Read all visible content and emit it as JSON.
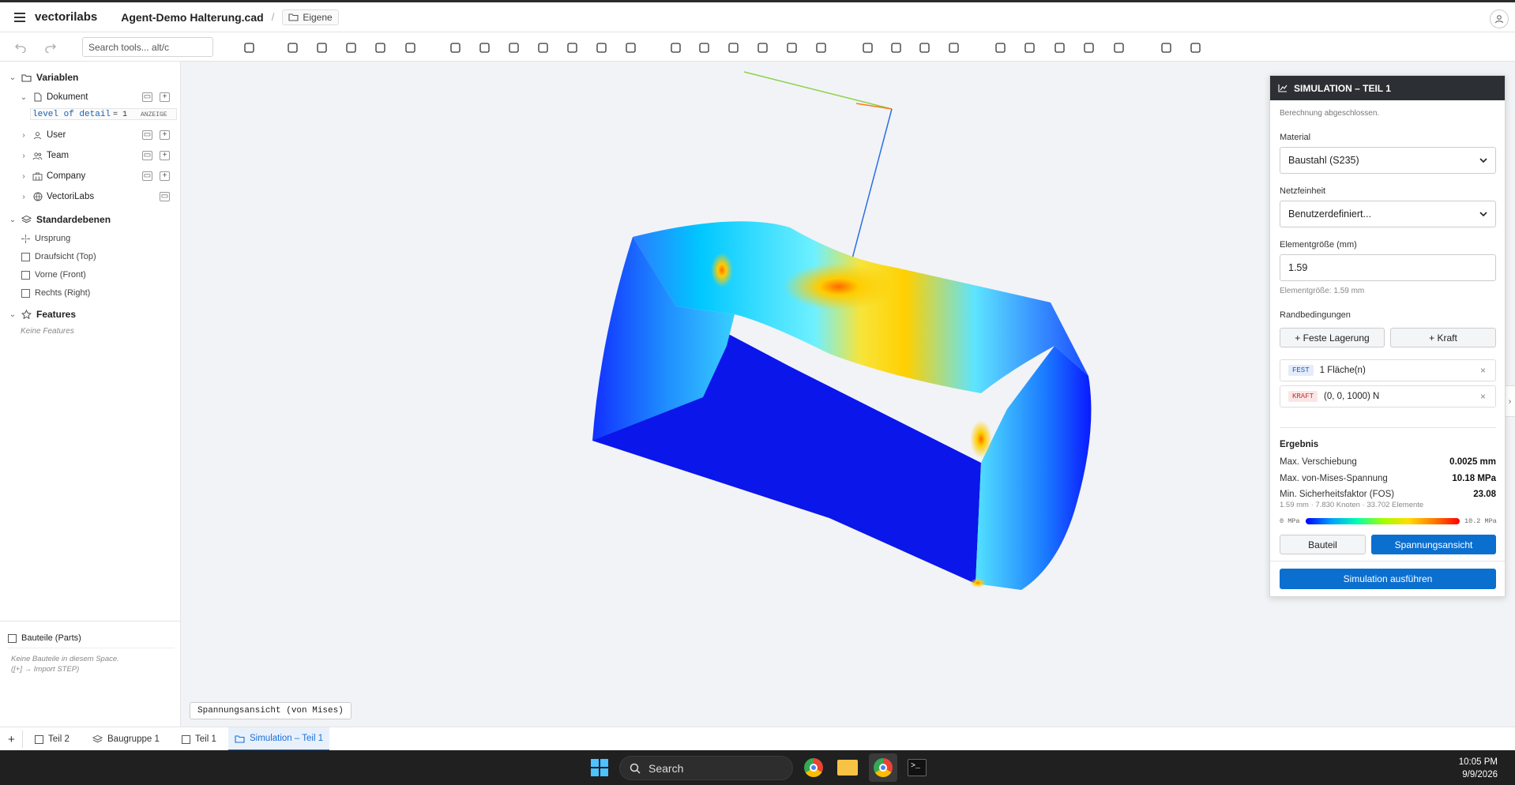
{
  "app": {
    "brand": "vectorilabs",
    "document": "Agent-Demo Halterung.cad",
    "breadcrumb_sep": "/",
    "folder": "Eigene"
  },
  "toolbar": {
    "search_placeholder": "Search tools... alt/c"
  },
  "sidebar": {
    "variables_title": "Variablen",
    "dokument": "Dokument",
    "variable": {
      "name": "level of detail",
      "value": "= 1",
      "badge": "ANZEIGE"
    },
    "user": "User",
    "team": "Team",
    "company": "Company",
    "vectorilabs": "VectoriLabs",
    "planes_title": "Standardebenen",
    "origin": "Ursprung",
    "plane_top": "Draufsicht (Top)",
    "plane_front": "Vorne (Front)",
    "plane_right": "Rechts (Right)",
    "features_title": "Features",
    "features_empty": "Keine Features",
    "parts_title": "Bauteile (Parts)",
    "parts_empty_1": "Keine Bauteile in diesem Space.",
    "parts_empty_2": "([+] → Import STEP)"
  },
  "viewport": {
    "view_label": "Spannungsansicht (von Mises)"
  },
  "panel": {
    "title": "SIMULATION – TEIL 1",
    "status": "Berechnung abgeschlossen.",
    "material_label": "Material",
    "material_value": "Baustahl (S235)",
    "mesh_label": "Netzfeinheit",
    "mesh_value": "Benutzerdefiniert...",
    "element_size_label": "Elementgröße (mm)",
    "element_size_value": "1.59",
    "element_size_hint": "Elementgröße: 1.59 mm",
    "bc_label": "Randbedingungen",
    "add_fixed": "+ Feste Lagerung",
    "add_force": "+ Kraft",
    "conditions": [
      {
        "tag": "FEST",
        "text": "1 Fläche(n)"
      },
      {
        "tag": "KRAFT",
        "text": "(0, 0, 1000) N"
      }
    ],
    "result_title": "Ergebnis",
    "results": [
      {
        "label": "Max. Verschiebung",
        "value": "0.0025 mm"
      },
      {
        "label": "Max. von-Mises-Spannung",
        "value": "10.18 MPa"
      },
      {
        "label": "Min. Sicherheitsfaktor (FOS)",
        "value": "23.08"
      }
    ],
    "mesh_info": "1.59 mm · 7.830 Knoten · 33.702 Elemente",
    "scale_min": "0 MPa",
    "scale_max": "10.2 MPa",
    "view_part": "Bauteil",
    "view_stress": "Spannungsansicht",
    "run": "Simulation ausführen",
    "accent": "#0b6fd0"
  },
  "tabs": [
    {
      "label": "Teil 2"
    },
    {
      "label": "Baugruppe 1"
    },
    {
      "label": "Teil 1"
    },
    {
      "label": "Simulation – Teil 1"
    }
  ],
  "taskbar": {
    "search": "Search",
    "time": "10:05 PM",
    "date": "9/9/2026"
  }
}
